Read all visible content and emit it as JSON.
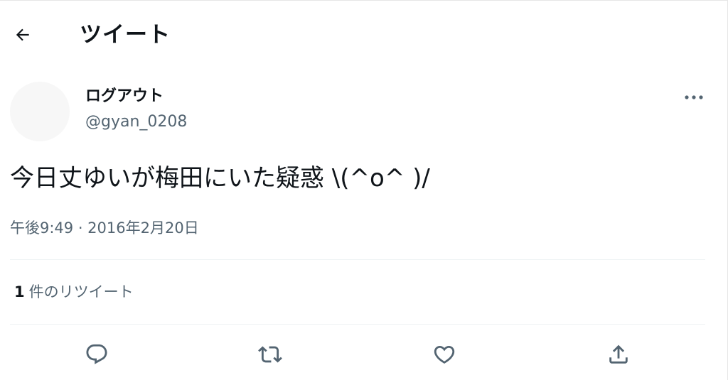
{
  "header": {
    "title": "ツイート"
  },
  "author": {
    "name": "ログアウト",
    "handle": "@gyan_0208"
  },
  "tweet": {
    "text": "今日丈ゆいが梅田にいた疑惑 \\(^o^ )/",
    "timestamp": "午後9:49 · 2016年2月20日"
  },
  "stats": {
    "retweet_count": "1",
    "retweet_label": "件のリツイート"
  },
  "icons": {
    "back": "arrow-left-icon",
    "more": "more-horizontal-icon",
    "reply": "reply-icon",
    "retweet": "retweet-icon",
    "like": "heart-icon",
    "share": "share-icon"
  },
  "colors": {
    "text": "#0f1419",
    "secondary": "#536471",
    "divider": "#eff3f4"
  }
}
